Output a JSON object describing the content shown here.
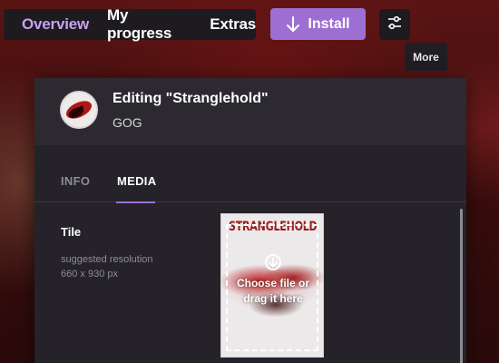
{
  "nav": {
    "tabs": [
      {
        "label": "Overview",
        "active": true
      },
      {
        "label": "My progress",
        "active": false
      },
      {
        "label": "Extras",
        "active": false
      }
    ],
    "install_label": "Install",
    "settings_icon": "sliders-icon"
  },
  "tooltip": {
    "text": "More"
  },
  "modal": {
    "title": "Editing \"Stranglehold\"",
    "platform": "GOG",
    "tabs": [
      {
        "label": "INFO",
        "active": false
      },
      {
        "label": "MEDIA",
        "active": true
      }
    ],
    "field": {
      "label": "Tile",
      "hint_line1": "suggested resolution",
      "hint_line2": "660 x 930 px"
    },
    "tile": {
      "brand_text": "STRANGLEHOLD",
      "upload_icon": "download-circle-icon",
      "upload_text": "Choose file or drag it here"
    }
  },
  "colors": {
    "accent": "#9d6fd3",
    "active_nav": "#c9a0f0",
    "panel": "#252329",
    "header": "#2c2a30",
    "nav_bg": "#1d1b20"
  }
}
